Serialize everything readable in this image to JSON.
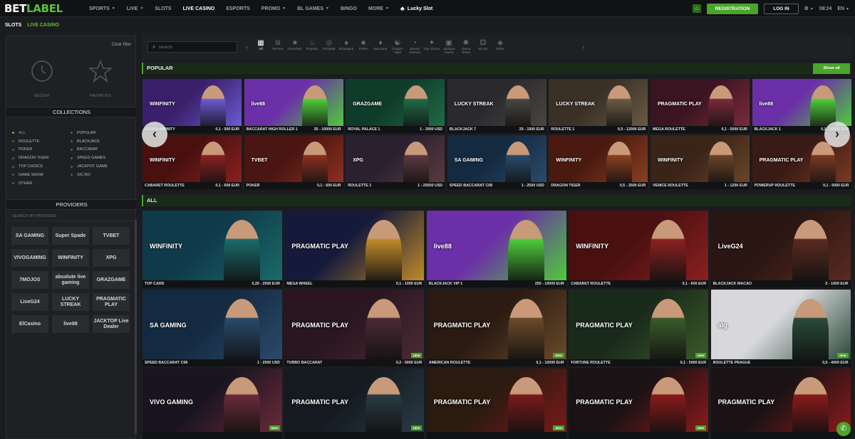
{
  "header": {
    "logo_a": "BET",
    "logo_b": "LABEL",
    "nav": [
      {
        "label": "SPORTS",
        "chevron": true
      },
      {
        "label": "LIVE",
        "chevron": true
      },
      {
        "label": "SLOTS",
        "chevron": false
      },
      {
        "label": "LIVE CASINO",
        "chevron": false,
        "active": true
      },
      {
        "label": "ESPORTS",
        "chevron": false
      },
      {
        "label": "PROMO",
        "chevron": true
      },
      {
        "label": "BL GAMES",
        "chevron": true
      },
      {
        "label": "BINGO",
        "chevron": false
      },
      {
        "label": "MORE",
        "chevron": true
      }
    ],
    "lucky_slot": "Lucky Slot",
    "registration": "REGISTRATION",
    "login": "LOG IN",
    "time": "08:24",
    "lang": "EN"
  },
  "breadcrumb": {
    "first": "SLOTS",
    "second": "LIVE CASINO"
  },
  "sidebar": {
    "clear_filter": "Clear filter",
    "recent": "RECENT",
    "favorites": "FAVORITES",
    "collections_title": "COLLECTIONS",
    "collections_left": [
      "ALL",
      "ROULETTE",
      "POKER",
      "DRAGON TIGER",
      "TOP CHOICE",
      "GAME SHOW",
      "OTHER"
    ],
    "collections_right": [
      "POPULAR",
      "BLACKJACK",
      "BACCARAT",
      "SPEED GAMES",
      "JACKPOT GAME",
      "SIC-BO"
    ],
    "providers_title": "PROVIDERS",
    "search_provider": "SEARCH BY PROVIDER",
    "providers": [
      "SA GAMING",
      "Super Spade",
      "TVBET",
      "VIVOGAMING",
      "WINFINITY",
      "XPG",
      "7MOJOS",
      "absolute live gaming",
      "GRAZGAME",
      "LiveG24",
      "LUCKY STREAK",
      "PRAGMATIC PLAY",
      "ElCasino",
      "live88",
      "JACKTOP Live Dealer"
    ]
  },
  "filter": {
    "search_placeholder": "search",
    "categories": [
      {
        "label": "All",
        "icon": "grid-icon",
        "glyph": "▦",
        "active": true
      },
      {
        "label": "Recent",
        "icon": "recent-icon",
        "glyph": "⧉"
      },
      {
        "label": "Favorites",
        "icon": "star-icon",
        "glyph": "★"
      },
      {
        "label": "Popular",
        "icon": "flame-icon",
        "glyph": "♨"
      },
      {
        "label": "Roulette",
        "icon": "roulette-icon",
        "glyph": "◎"
      },
      {
        "label": "Blackjack",
        "icon": "cards-icon",
        "glyph": "♠"
      },
      {
        "label": "Poker",
        "icon": "poker-icon",
        "glyph": "♣"
      },
      {
        "label": "Baccarat",
        "icon": "baccarat-icon",
        "glyph": "♦"
      },
      {
        "label": "Dragon Tiger",
        "icon": "dragon-icon",
        "glyph": "☯"
      },
      {
        "label": "Speed Games",
        "icon": "speed-icon",
        "glyph": "◔"
      },
      {
        "label": "Top choice",
        "icon": "top-icon",
        "glyph": "✦"
      },
      {
        "label": "Jackpot Game",
        "icon": "jackpot-icon",
        "glyph": "▣"
      },
      {
        "label": "Game Show",
        "icon": "wheel-icon",
        "glyph": "✺"
      },
      {
        "label": "Sic-Bo",
        "icon": "dice-icon",
        "glyph": "⚃"
      },
      {
        "label": "Other",
        "icon": "other-icon",
        "glyph": "◈"
      }
    ]
  },
  "popular": {
    "title": "POPULAR",
    "show_all": "Show all",
    "tiles": [
      {
        "name": "ADORA INFINITY",
        "limits": "0,1 - 500 EUR",
        "brand": "WINFINITY",
        "bg": "#3a1f6b",
        "fg": "#6a5bd1"
      },
      {
        "name": "BACCARAT HIGH ROLLER 1",
        "limits": "25 - 10000 EUR",
        "brand": "live88",
        "bg": "#6b2fa8",
        "fg": "#4ecb3a"
      },
      {
        "name": "ROYAL PALACE 1",
        "limits": "1 - 3000 USD",
        "brand": "GRAZGAME",
        "bg": "#0f3b2a",
        "fg": "#1f6b46"
      },
      {
        "name": "BLACKJACK 7",
        "limits": "25 - 1500 EUR",
        "brand": "LUCKY STREAK",
        "bg": "#2a2a2e",
        "fg": "#4a4540"
      },
      {
        "name": "ROULETTE 1",
        "limits": "0,5 - 12000 EUR",
        "brand": "LUCKY STREAK",
        "bg": "#3a3026",
        "fg": "#6a5a44"
      },
      {
        "name": "MEGA ROULETTE",
        "limits": "0,1 - 5000 EUR",
        "brand": "PRAGMATIC PLAY",
        "bg": "#3a1420",
        "fg": "#7a2a3a"
      },
      {
        "name": "BLACKJACK 1",
        "limits": "0,1 - 10000 EUR",
        "brand": "live88",
        "bg": "#6b2fa8",
        "fg": "#4ecb3a"
      },
      {
        "name": "CABARET ROULETTE",
        "limits": "0,1 - 600 EUR",
        "brand": "WINFINITY",
        "bg": "#4a1010",
        "fg": "#8a2020"
      },
      {
        "name": "POKER",
        "limits": "0,1 - 500 EUR",
        "brand": "TVBET",
        "bg": "#4a1512",
        "fg": "#8a3020"
      },
      {
        "name": "ROULETTE 1",
        "limits": "1 - 25000 USD",
        "brand": "XPG",
        "bg": "#2a2030",
        "fg": "#5a3a40"
      },
      {
        "name": "SPEED BACCARAT C08",
        "limits": "1 - 2500 USD",
        "brand": "SA GAMING",
        "bg": "#142a40",
        "fg": "#2a4a6a"
      },
      {
        "name": "DRAGON TIGER",
        "limits": "0,5 - 2500 EUR",
        "brand": "WINFINITY",
        "bg": "#4a1a10",
        "fg": "#8a4020"
      },
      {
        "name": "VENICE ROULETTE",
        "limits": "1 - 1200 EUR",
        "brand": "WINFINITY",
        "bg": "#3a2418",
        "fg": "#6a4428"
      },
      {
        "name": "POWERUP ROULETTE",
        "limits": "0,1 - 5000 EUR",
        "brand": "PRAGMATIC PLAY",
        "bg": "#3a1a14",
        "fg": "#7a3a24"
      }
    ]
  },
  "all": {
    "title": "ALL",
    "new_badge": "NEW",
    "tiles": [
      {
        "name": "TOP CARD",
        "limits": "0,25 - 2500 EUR",
        "brand": "WINFINITY",
        "bg": "#0f3a4a",
        "fg": "#1a6a6a",
        "new": false
      },
      {
        "name": "MEGA WHEEL",
        "limits": "0,1 - 1000 EUR",
        "brand": "PRAGMATIC PLAY",
        "bg": "#161a3a",
        "fg": "#c08a2a",
        "new": false
      },
      {
        "name": "BLACKJACK VIP 1",
        "limits": "250 - 10000 EUR",
        "brand": "live88",
        "bg": "#6b2fa8",
        "fg": "#4ecb3a",
        "new": false
      },
      {
        "name": "CABARET ROULETTE",
        "limits": "0,1 - 600 EUR",
        "brand": "WINFINITY",
        "bg": "#4a1010",
        "fg": "#8a2020",
        "new": false
      },
      {
        "name": "BLACKJACK MACAO",
        "limits": "5 - 1000 EUR",
        "brand": "LiveG24",
        "bg": "#2a1612",
        "fg": "#5a2a20",
        "new": false
      },
      {
        "name": "SPEED BACCARAT C08",
        "limits": "1 - 2500 USD",
        "brand": "SA GAMING",
        "bg": "#142a40",
        "fg": "#2a4a6a",
        "new": false
      },
      {
        "name": "TURBO BACCARAT",
        "limits": "0,2 - 5000 EUR",
        "brand": "PRAGMATIC PLAY",
        "bg": "#2a1620",
        "fg": "#4a2a34",
        "new": true
      },
      {
        "name": "AMERICAN ROULETTE",
        "limits": "0,1 - 10000 EUR",
        "brand": "PRAGMATIC PLAY",
        "bg": "#2a1a12",
        "fg": "#6a4a2a",
        "new": true
      },
      {
        "name": "FORTUNE ROULETTE",
        "limits": "0,1 - 5000 EUR",
        "brand": "PRAGMATIC PLAY",
        "bg": "#1a2a1a",
        "fg": "#3a5a2a",
        "new": true
      },
      {
        "name": "ROULETTE PRAGUE",
        "limits": "0,5 - 4000 EUR",
        "brand": "alg",
        "bg": "#d8d8dc",
        "fg": "#2a4a3a",
        "new": true
      },
      {
        "name": "",
        "limits": "",
        "brand": "VIVO GAMING",
        "bg": "#1a1420",
        "fg": "#6a2a3a",
        "new": true
      },
      {
        "name": "",
        "limits": "",
        "brand": "PRAGMATIC PLAY",
        "bg": "#141a20",
        "fg": "#2a3a44",
        "new": true
      },
      {
        "name": "",
        "limits": "",
        "brand": "PRAGMATIC PLAY",
        "bg": "#2a1a10",
        "fg": "#7a1a1a",
        "new": true
      },
      {
        "name": "",
        "limits": "",
        "brand": "PRAGMATIC PLAY",
        "bg": "#1a1214",
        "fg": "#8a1a1a",
        "new": true
      },
      {
        "name": "",
        "limits": "",
        "brand": "PRAGMATIC PLAY",
        "bg": "#1a1214",
        "fg": "#8a1a1a",
        "new": true
      }
    ]
  },
  "colors": {
    "accent": "#4aa52a",
    "bg": "#1b1c1f"
  }
}
